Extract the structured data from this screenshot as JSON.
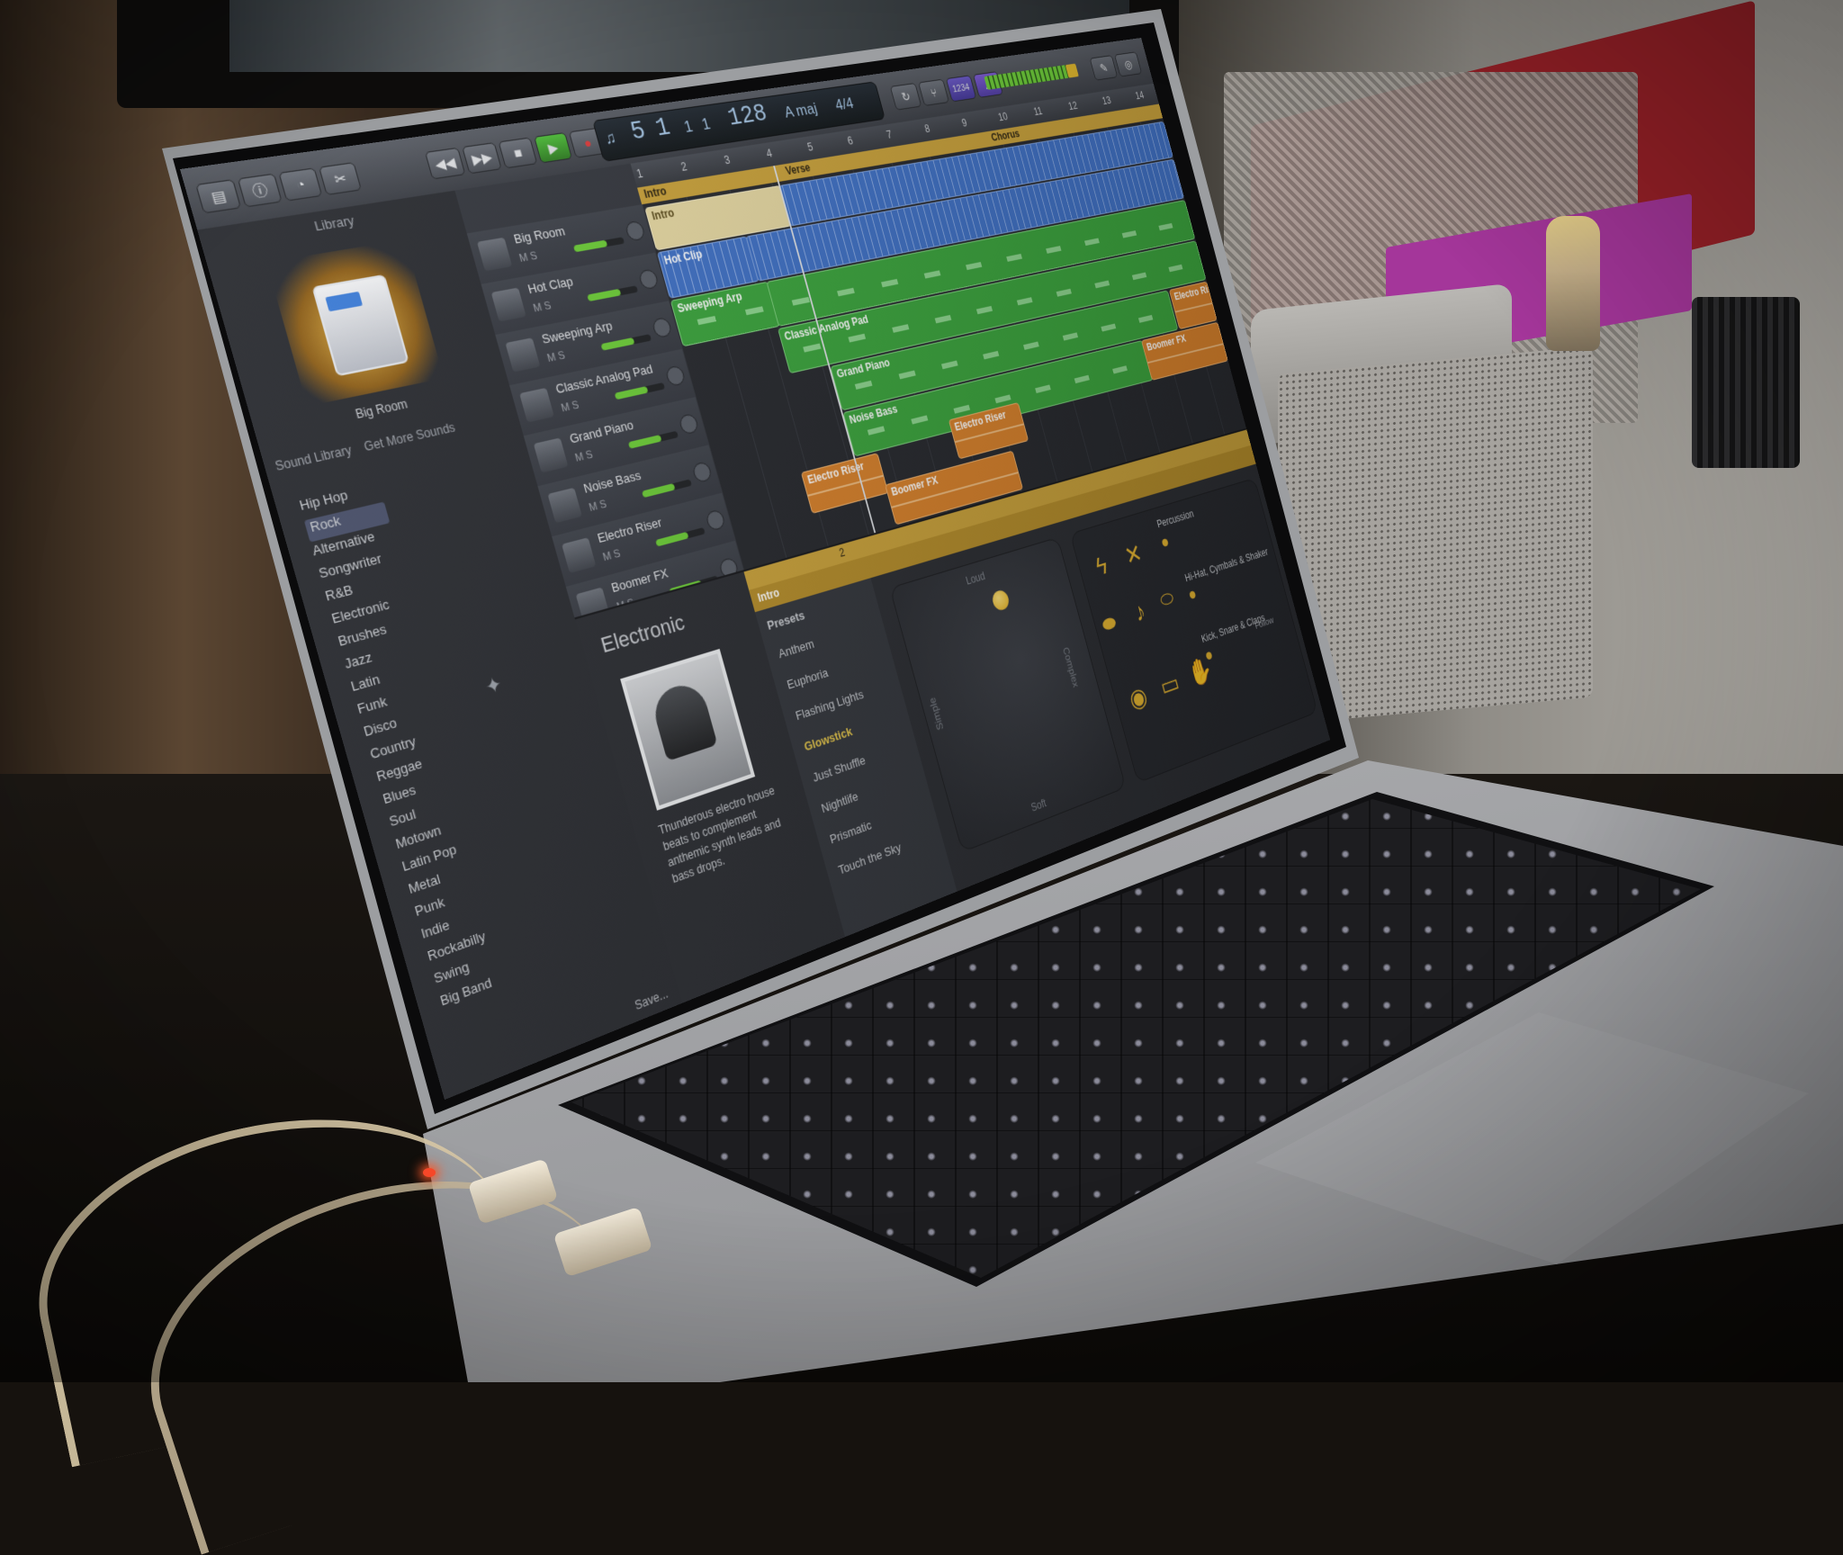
{
  "app": {
    "name": "GarageBand",
    "accent": "#caa23a",
    "region_colors": {
      "audio": "#3f71c6",
      "midi": "#3aa43c",
      "fx": "#d8812a"
    }
  },
  "toolbar": {
    "buttons": [
      {
        "icon": "library-icon"
      },
      {
        "icon": "info-icon"
      },
      {
        "icon": "smart-controls-icon"
      },
      {
        "icon": "editor-icon"
      },
      {
        "icon": "rewind-icon"
      },
      {
        "icon": "fast-forward-icon"
      },
      {
        "icon": "stop-icon"
      },
      {
        "icon": "play-icon"
      },
      {
        "icon": "record-icon"
      },
      {
        "icon": "cycle-icon"
      },
      {
        "icon": "tuner-icon"
      },
      {
        "icon": "count-in-icon"
      },
      {
        "icon": "metronome-icon"
      },
      {
        "icon": "notepad-icon"
      },
      {
        "icon": "loop-browser-icon"
      }
    ],
    "lcd": {
      "bar": "5",
      "beat": "1",
      "div": "1",
      "tick": "1",
      "tempo": "128",
      "key": "A maj",
      "time_sig": "4/4"
    },
    "count_in_label": "1234"
  },
  "library": {
    "header": "Library",
    "selected_name": "Big Room",
    "tabs": [
      "Sound Library",
      "Get More Sounds"
    ],
    "items": [
      "Hip Hop",
      "Rock",
      "Alternative",
      "Songwriter",
      "R&B",
      "Electronic",
      "Brushes",
      "Jazz",
      "Latin",
      "Funk",
      "Disco",
      "Country",
      "Reggae",
      "Blues",
      "Soul",
      "Motown",
      "Latin Pop",
      "Metal",
      "Punk",
      "Indie",
      "Rockabilly",
      "Swing",
      "Big Band"
    ],
    "selected_index": 1,
    "save_label": "Save..."
  },
  "tracks": [
    {
      "name": "Big Room",
      "ms": "M S"
    },
    {
      "name": "Hot Clap",
      "ms": "M S"
    },
    {
      "name": "Sweeping Arp",
      "ms": "M S"
    },
    {
      "name": "Classic Analog Pad",
      "ms": "M S"
    },
    {
      "name": "Grand Piano",
      "ms": "M S"
    },
    {
      "name": "Noise Bass",
      "ms": "M S"
    },
    {
      "name": "Electro Riser",
      "ms": "M S"
    },
    {
      "name": "Boomer FX",
      "ms": "M S"
    }
  ],
  "arrange": {
    "ruler": [
      "1",
      "2",
      "3",
      "4",
      "5",
      "6",
      "7",
      "8",
      "9",
      "10",
      "11",
      "12",
      "13",
      "14"
    ],
    "markers": [
      "Intro",
      "Verse",
      "Chorus"
    ],
    "regions": {
      "intro": "Intro",
      "hot_clip": "Hot Clip",
      "sweeping_arp": "Sweeping Arp",
      "classic_analog_pad": "Classic Analog Pad",
      "grand_piano": "Grand Piano",
      "noise_bass": "Noise Bass",
      "electro_riser_1": "Electro Riser",
      "electro_riser_2": "Electro Riser",
      "electro_riser_3": "Electro Riser",
      "boomer_fx_1": "Boomer FX",
      "boomer_fx_2": "Boomer FX"
    }
  },
  "editor": {
    "ruler_num": "2",
    "region_label": "Intro",
    "genre": "Electronic",
    "drummer_description": "Thunderous electro house beats to complement anthemic synth leads and bass drops.",
    "presets_title": "Presets",
    "presets": [
      "Anthem",
      "Euphoria",
      "Flashing Lights",
      "Glowstick",
      "Just Shuffle",
      "Nightlife",
      "Prismatic",
      "Touch the Sky"
    ],
    "selected_preset": "Glowstick",
    "xy_pad": {
      "top": "Loud",
      "bottom": "Soft",
      "left": "Simple",
      "right": "Complex"
    },
    "kit": {
      "percussion_label": "Percussion",
      "cymbals_label": "Hi-Hat, Cymbals & Shaker",
      "kick_label": "Kick, Snare & Claps",
      "follow_label": "Follow"
    }
  }
}
